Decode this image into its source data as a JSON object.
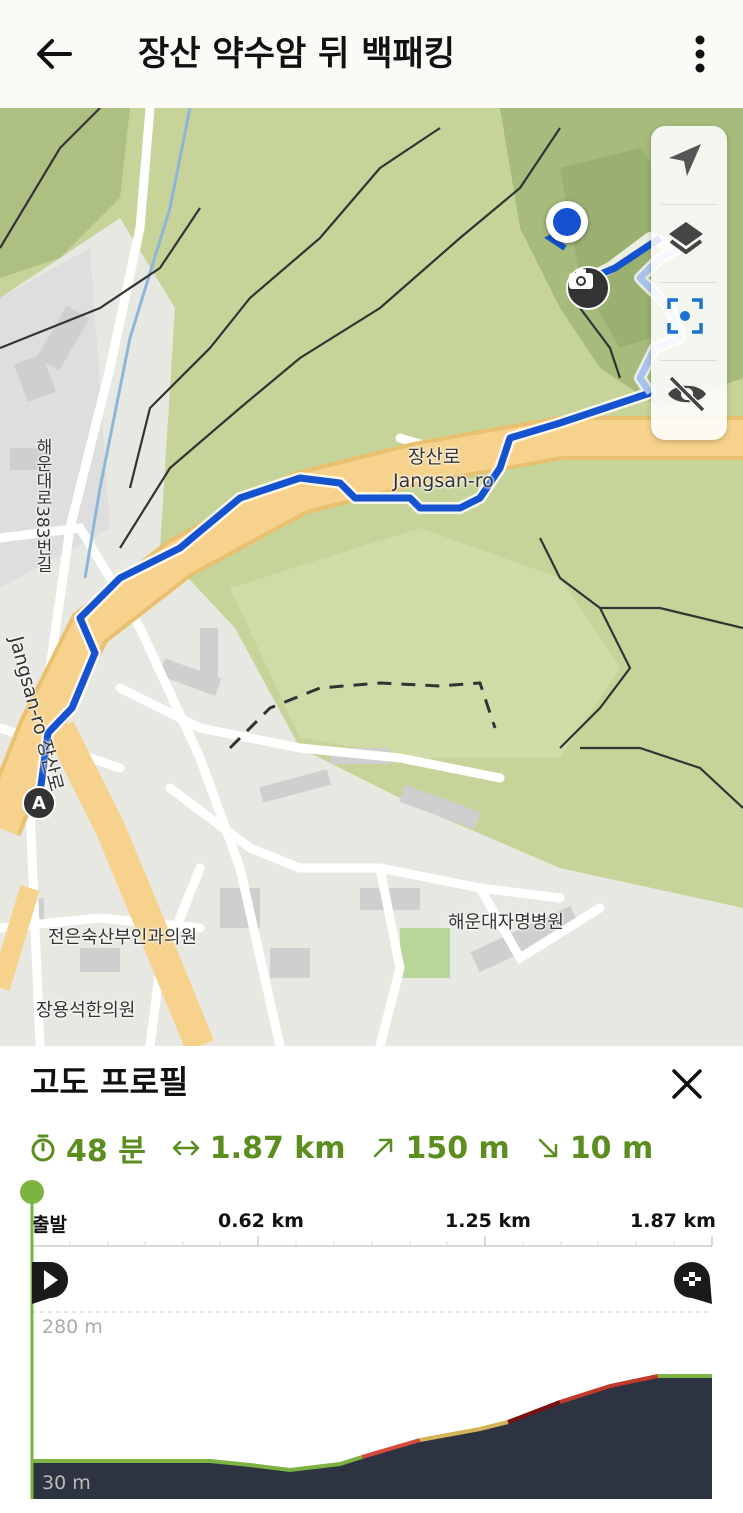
{
  "header": {
    "title": "장산 약수암 뒤 백패킹",
    "back_icon": "arrow-left-icon",
    "more_icon": "more-vertical-icon"
  },
  "map": {
    "labels": {
      "road_ko": "장산로",
      "road_en": "Jangsan-ro",
      "street_vertical": "해운대로383번길",
      "road_vertical": "Jangsan-ro 장산로",
      "clinic1": "전은숙산부인과의원",
      "clinic2": "장용석한의원",
      "hospital": "해운대자명병원"
    },
    "start_marker": "A",
    "controls": [
      "navigate-icon",
      "layers-icon",
      "center-focus-icon",
      "eye-off-icon"
    ],
    "colors": {
      "route": "#1552d0",
      "road_major": "#f3c97a",
      "terrain": "#c8d59c"
    }
  },
  "profile": {
    "title": "고도 프로필",
    "stats": {
      "duration": "48 분",
      "distance": "1.87 km",
      "ascent": "150 m",
      "descent": "10 m"
    },
    "distance_ticks": [
      "출발",
      "0.62 km",
      "1.25 km",
      "1.87 km"
    ],
    "elevation_top": "280 m",
    "elevation_bottom": "30 m",
    "accent_color": "#7cb342"
  }
}
